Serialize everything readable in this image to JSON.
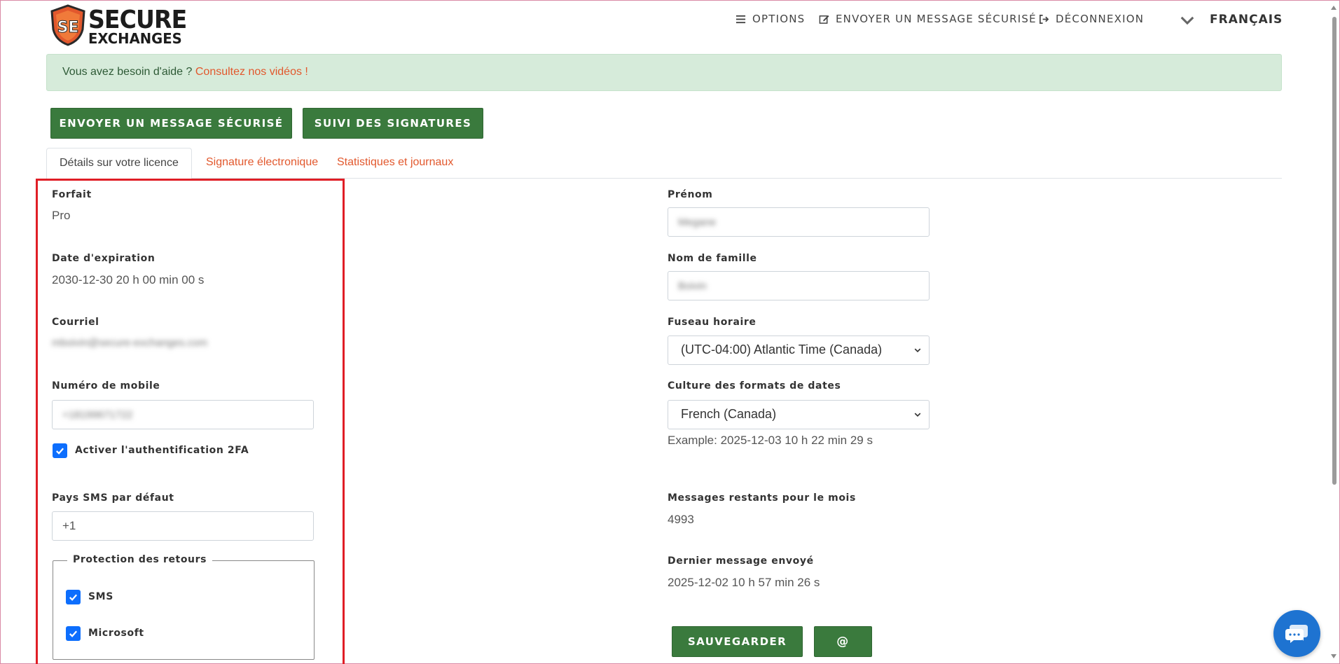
{
  "brand": {
    "logo_line1": "SECURE",
    "logo_line2": "EXCHANGES",
    "badge_text": "SE",
    "accent_color": "#e2582d",
    "green_color": "#3a7a3d"
  },
  "topnav": {
    "options": "OPTIONS",
    "send": "ENVOYER UN MESSAGE SÉCURISÉ",
    "logout": "DÉCONNEXION",
    "language": "FRANÇAIS"
  },
  "help": {
    "text": "Vous avez besoin d'aide ?",
    "link": "Consultez nos vidéos !"
  },
  "actions": {
    "send": "ENVOYER UN MESSAGE SÉCURISÉ",
    "track": "SUIVI DES SIGNATURES"
  },
  "tabs": [
    {
      "label": "Détails sur votre licence",
      "active": true
    },
    {
      "label": "Signature électronique",
      "active": false
    },
    {
      "label": "Statistiques et journaux",
      "active": false
    }
  ],
  "left": {
    "plan_label": "Forfait",
    "plan_value": "Pro",
    "expiry_label": "Date d'expiration",
    "expiry_value": "2030-12-30 20 h 00 min 00 s",
    "email_label": "Courriel",
    "email_value": "mboivin@secure-exchanges.com",
    "mobile_label": "Numéro de mobile",
    "mobile_value": "+18199671722",
    "twofa_label": "Activer l'authentification 2FA",
    "twofa_checked": true,
    "sms_country_label": "Pays SMS par défaut",
    "sms_country_value": "+1",
    "return_protection_legend": "Protection des retours",
    "return_sms_label": "SMS",
    "return_sms_checked": true,
    "return_microsoft_label": "Microsoft",
    "return_microsoft_checked": true
  },
  "right": {
    "firstname_label": "Prénom",
    "firstname_value": "Megane",
    "lastname_label": "Nom de famille",
    "lastname_value": "Boivin",
    "timezone_label": "Fuseau horaire",
    "timezone_value": "(UTC-04:00) Atlantic Time (Canada)",
    "culture_label": "Culture des formats de dates",
    "culture_value": "French (Canada)",
    "culture_example": "Example: 2025-12-03 10 h 22 min 29 s",
    "remaining_label": "Messages restants pour le mois",
    "remaining_value": "4993",
    "last_sent_label": "Dernier message envoyé",
    "last_sent_value": "2025-12-02 10 h 57 min 26 s",
    "save_button": "SAUVEGARDER",
    "at_button": "@"
  },
  "icons": {
    "options": "list-icon",
    "send": "edit-icon",
    "logout": "sign-out-icon",
    "language": "chevron-down-icon",
    "chat": "chat-icon"
  }
}
